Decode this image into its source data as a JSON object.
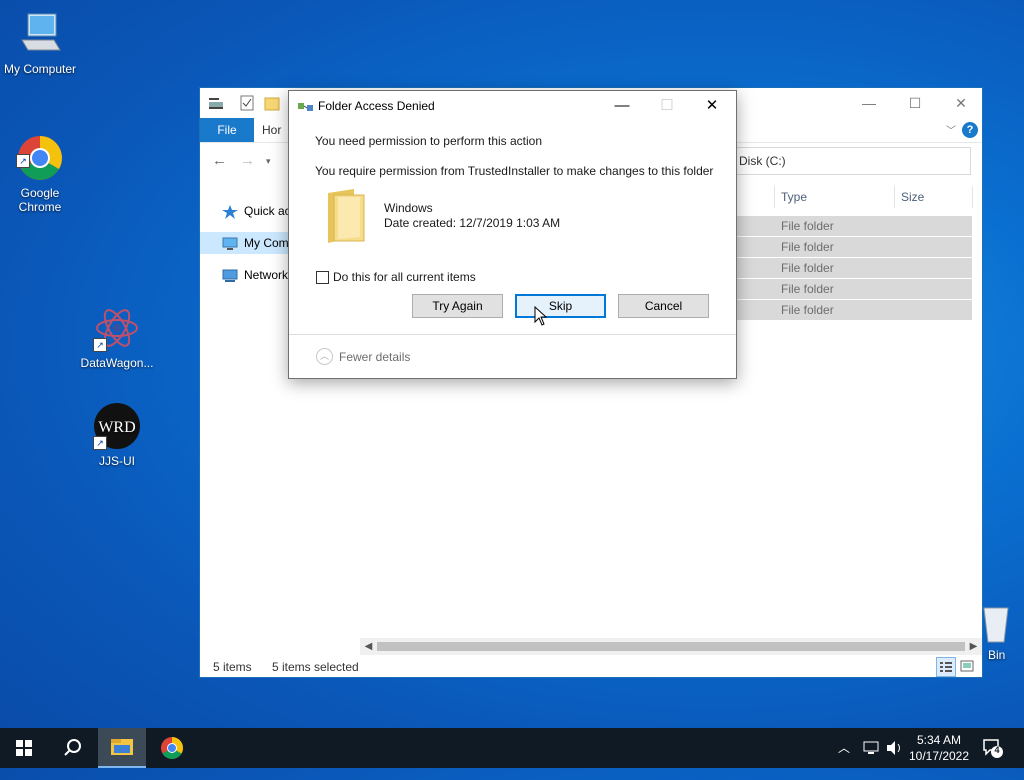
{
  "desktop": {
    "icons": [
      {
        "label": "My Computer"
      },
      {
        "label": "Google\nChrome"
      },
      {
        "label": "DataWagon..."
      },
      {
        "label": "JJS-UI"
      },
      {
        "label": "Bin"
      }
    ]
  },
  "explorer": {
    "ribbon": {
      "file_tab": "File",
      "home_tab": "Hor"
    },
    "address": "Disk (C:)",
    "nav_items": [
      {
        "label": "Quick ac"
      },
      {
        "label": "My Com"
      },
      {
        "label": "Network"
      }
    ],
    "columns": {
      "type": "Type",
      "size": "Size"
    },
    "rows": [
      {
        "type": "File folder"
      },
      {
        "type": "File folder"
      },
      {
        "type": "File folder"
      },
      {
        "type": "File folder"
      },
      {
        "type": "File folder"
      }
    ],
    "status": {
      "items": "5 items",
      "selected": "5 items selected"
    }
  },
  "dialog": {
    "title": "Folder Access Denied",
    "heading": "You need permission to perform this action",
    "message": "You require permission from TrustedInstaller to make changes to this folder",
    "item_name": "Windows",
    "item_date": "Date created: 12/7/2019 1:03 AM",
    "checkbox_label": "Do this for all current items",
    "buttons": {
      "try_again": "Try Again",
      "skip": "Skip",
      "cancel": "Cancel"
    },
    "fewer_details": "Fewer details"
  },
  "taskbar": {
    "time": "5:34 AM",
    "date": "10/17/2022",
    "notifications": "4"
  }
}
